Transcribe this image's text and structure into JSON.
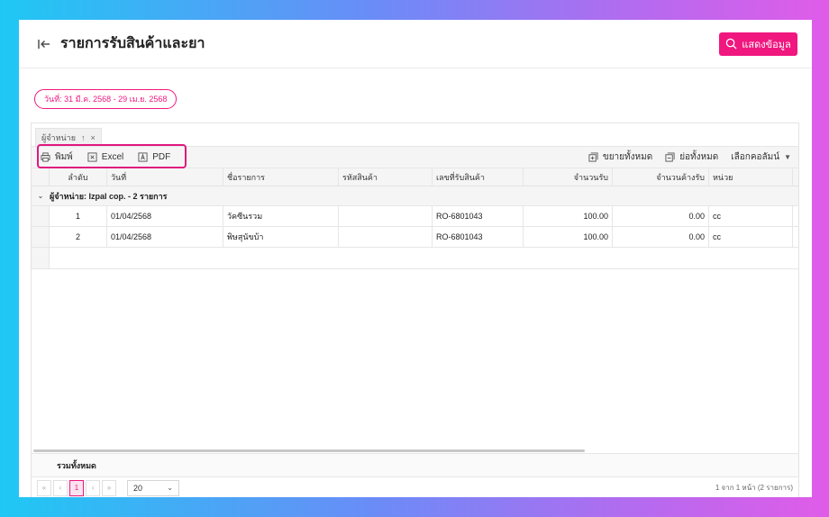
{
  "header": {
    "title": "รายการรับสินค้าและยา",
    "show_button": "แสดงข้อมูล"
  },
  "filter": {
    "date_range": "วันที่: 31 มี.ค. 2568 - 29 เม.ย. 2568"
  },
  "group_panel": {
    "chip_label": "ผู้จำหน่าย"
  },
  "toolbar": {
    "print_label": "พิมพ์",
    "excel_label": "Excel",
    "pdf_label": "PDF",
    "expand_all_label": "ขยายทั้งหมด",
    "collapse_all_label": "ย่อทั้งหมด",
    "choose_columns_label": "เลือกคอลัมน์"
  },
  "table": {
    "columns": [
      "ลำดับ",
      "วันที่",
      "ชื่อรายการ",
      "รหัสสินค้า",
      "เลขที่รับสินค้า",
      "จำนวนรับ",
      "จำนวนค้างรับ",
      "หน่วย"
    ],
    "group_label": "ผู้จำหน่าย: Izpal cop. - 2 รายการ",
    "rows": [
      {
        "no": "1",
        "date": "01/04/2568",
        "name": "วัคซีนรวม",
        "code": "",
        "ref": "RO-6801043",
        "qty": "100.00",
        "remain": "0.00",
        "unit": "cc"
      },
      {
        "no": "2",
        "date": "01/04/2568",
        "name": "พิษสุนัขบ้า",
        "code": "",
        "ref": "RO-6801043",
        "qty": "100.00",
        "remain": "0.00",
        "unit": "cc"
      }
    ],
    "summary_label": "รวมทั้งหมด"
  },
  "pager": {
    "current_page": "1",
    "page_size": "20",
    "info": "1 จาก 1 หน้า (2 รายการ)"
  },
  "colors": {
    "accent": "#f0177f"
  }
}
